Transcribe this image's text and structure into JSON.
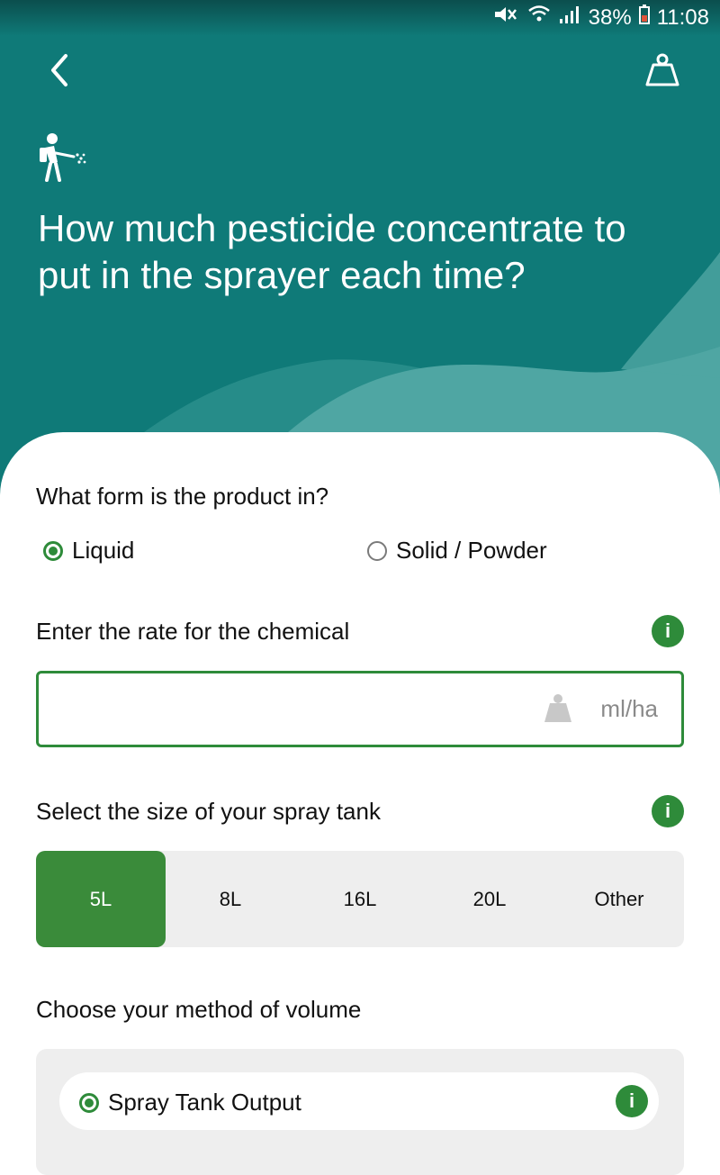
{
  "status_bar": {
    "battery": "38%",
    "time": "11:08"
  },
  "header": {
    "title_line1": "How much pesticide concentrate to",
    "title_line2": "put in the sprayer each time?"
  },
  "product_form": {
    "question": "What form is the product in?",
    "options": [
      {
        "label": "Liquid",
        "selected": true
      },
      {
        "label": "Solid / Powder",
        "selected": false
      }
    ]
  },
  "rate": {
    "label": "Enter the rate for the chemical",
    "value": "",
    "unit": "ml/ha"
  },
  "tank": {
    "label": "Select the size of your spray tank",
    "options": [
      "5L",
      "8L",
      "16L",
      "20L",
      "Other"
    ],
    "selected": "5L"
  },
  "method": {
    "label": "Choose your method of volume",
    "options": [
      {
        "label": "Spray Tank Output",
        "selected": true
      }
    ]
  },
  "colors": {
    "header": "#0f7a78",
    "accent": "#2e8b3a",
    "selected_segment": "#3a8b3a"
  }
}
